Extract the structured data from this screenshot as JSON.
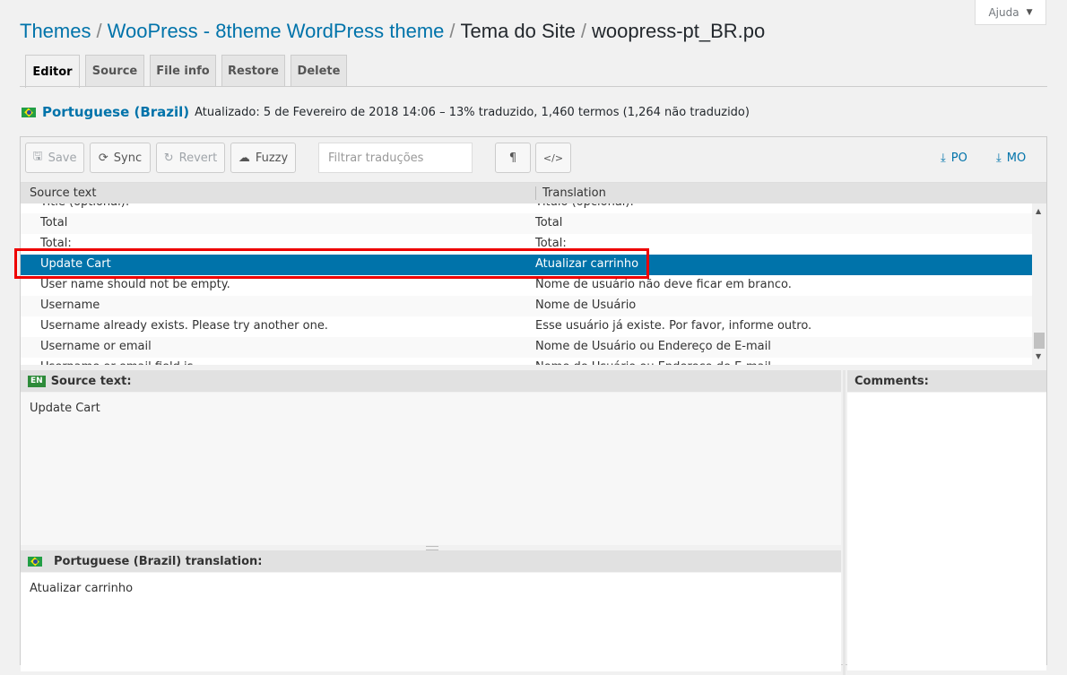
{
  "help": {
    "label": "Ajuda"
  },
  "breadcrumb": {
    "themes": "Themes",
    "theme": "WooPress - 8theme WordPress theme",
    "domain": "Tema do Site",
    "file": "woopress-pt_BR.po",
    "sep": "/"
  },
  "tabs": {
    "editor": "Editor",
    "source": "Source",
    "fileinfo": "File info",
    "restore": "Restore",
    "delete": "Delete"
  },
  "status": {
    "language": "Portuguese (Brazil)",
    "details": "Atualizado: 5 de Fevereiro de 2018 14:06 – 13% traduzido, 1,460 termos (1,264 não traduzido)"
  },
  "toolbar": {
    "save": "Save",
    "sync": "Sync",
    "revert": "Revert",
    "fuzzy": "Fuzzy",
    "filter_placeholder": "Filtrar traduções",
    "pilcrow": "¶",
    "code": "</>",
    "po": "PO",
    "mo": "MO"
  },
  "list": {
    "headers": {
      "source": "Source text",
      "translation": "Translation"
    },
    "rows": [
      {
        "source": "Title (optional):",
        "translation": "Título (opcional):"
      },
      {
        "source": "Total",
        "translation": "Total"
      },
      {
        "source": "Total:",
        "translation": "Total:"
      },
      {
        "source": "Update Cart",
        "translation": "Atualizar carrinho"
      },
      {
        "source": "User name should not be empty.",
        "translation": "Nome de usuário não deve ficar em branco."
      },
      {
        "source": "Username",
        "translation": "Nome de Usuário"
      },
      {
        "source": "Username already exists. Please try another one.",
        "translation": "Esse usuário já existe. Por favor, informe outro."
      },
      {
        "source": "Username or email",
        "translation": "Nome de Usuário ou Endereço de E-mail"
      },
      {
        "source": "Username or email field is...",
        "translation": "Nome de Usuário ou Endereço de E-mail..."
      }
    ],
    "selected_index": 3
  },
  "source_pane": {
    "badge": "EN",
    "title": "Source text:",
    "text": "Update Cart"
  },
  "translation_pane": {
    "title": "Portuguese (Brazil) translation:",
    "text": "Atualizar carrinho"
  },
  "comments_pane": {
    "title": "Comments:"
  },
  "colors": {
    "accent": "#0073aa",
    "highlight": "#e00000"
  }
}
